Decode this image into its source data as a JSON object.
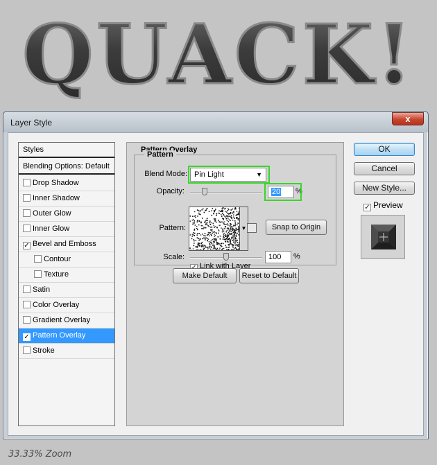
{
  "canvas": {
    "headline": "QUACK!",
    "zoom": "33.33% Zoom"
  },
  "dialog": {
    "title": "Layer Style",
    "close_glyph": "x"
  },
  "styles_list": {
    "header": "Styles",
    "blending": "Blending Options: Default",
    "items": [
      {
        "label": "Drop Shadow",
        "checked": false,
        "indent": false,
        "selected": false
      },
      {
        "label": "Inner Shadow",
        "checked": false,
        "indent": false,
        "selected": false
      },
      {
        "label": "Outer Glow",
        "checked": false,
        "indent": false,
        "selected": false
      },
      {
        "label": "Inner Glow",
        "checked": false,
        "indent": false,
        "selected": false
      },
      {
        "label": "Bevel and Emboss",
        "checked": true,
        "indent": false,
        "selected": false
      },
      {
        "label": "Contour",
        "checked": false,
        "indent": true,
        "selected": false
      },
      {
        "label": "Texture",
        "checked": false,
        "indent": true,
        "selected": false
      },
      {
        "label": "Satin",
        "checked": false,
        "indent": false,
        "selected": false
      },
      {
        "label": "Color Overlay",
        "checked": false,
        "indent": false,
        "selected": false
      },
      {
        "label": "Gradient Overlay",
        "checked": false,
        "indent": false,
        "selected": false
      },
      {
        "label": "Pattern Overlay",
        "checked": true,
        "indent": false,
        "selected": true
      },
      {
        "label": "Stroke",
        "checked": false,
        "indent": false,
        "selected": false
      }
    ]
  },
  "panel": {
    "title": "Pattern Overlay",
    "group": "Pattern",
    "blend_mode_label": "Blend Mode:",
    "blend_mode_value": "Pin Light",
    "opacity_label": "Opacity:",
    "opacity_value": "20",
    "opacity_fraction": 0.2,
    "percent": "%",
    "pattern_label": "Pattern:",
    "snap_button": "Snap to Origin",
    "scale_label": "Scale:",
    "scale_value": "100",
    "scale_fraction": 0.5,
    "link_label": "Link with Layer",
    "link_checked": true,
    "make_default": "Make Default",
    "reset_default": "Reset to Default",
    "checkmark": "✓"
  },
  "side_buttons": {
    "ok": "OK",
    "cancel": "Cancel",
    "new_style": "New Style...",
    "preview_label": "Preview",
    "preview_checked": true
  },
  "colors": {
    "highlight": "#39d62a",
    "selection": "#3399ff"
  }
}
